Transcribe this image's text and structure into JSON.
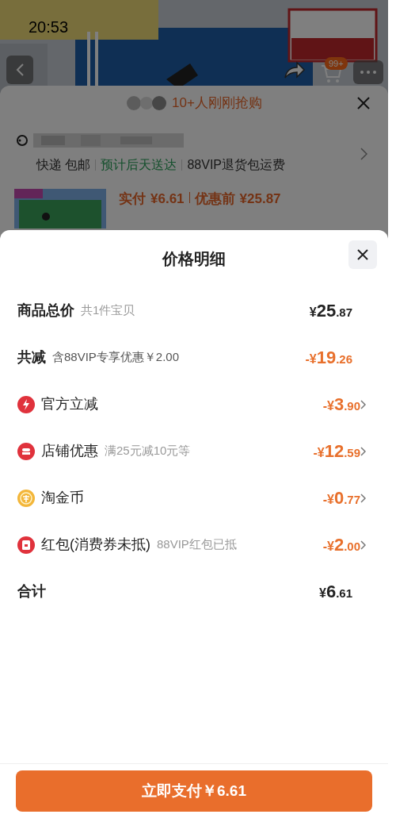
{
  "status_bar": {
    "time": "20:53"
  },
  "product_header": {
    "cart_badge": "99+"
  },
  "purchase_sheet": {
    "buyers_note": "10+人刚刚抢购",
    "delivery": [
      {
        "text": "快递 包邮",
        "kind": "plain"
      },
      {
        "text": "预计后天送达",
        "kind": "highlight"
      },
      {
        "text": "88VIP退货包运费",
        "kind": "plain"
      }
    ],
    "paid_label": "实付",
    "paid_price": "¥6.61",
    "before_label": "优惠前",
    "before_price": "¥25.87"
  },
  "price_detail": {
    "title": "价格明细",
    "rows": [
      {
        "kind": "header",
        "label": "商品总价",
        "note": "共1件宝贝",
        "amount": "¥25.87",
        "discount": false
      },
      {
        "kind": "header",
        "label": "共减",
        "note": "含88VIP专享优惠￥2.00",
        "amount": "-¥19.26",
        "discount": true
      },
      {
        "kind": "bolt",
        "label": "官方立减",
        "amount": "-¥3.90",
        "discount": true
      },
      {
        "kind": "store",
        "label": "店铺优惠",
        "note": "满25元减10元等",
        "amount": "-¥12.59",
        "discount": true
      },
      {
        "kind": "coin",
        "label": "淘金币",
        "amount": "-¥0.77",
        "discount": true
      },
      {
        "kind": "packet",
        "label": "红包(消费券未抵)",
        "note": "88VIP红包已抵",
        "amount": "-¥2.00",
        "discount": true
      },
      {
        "kind": "total",
        "label": "合计",
        "amount": "¥6.61",
        "discount": false
      }
    ],
    "pay_button": "立即支付￥6.61"
  }
}
